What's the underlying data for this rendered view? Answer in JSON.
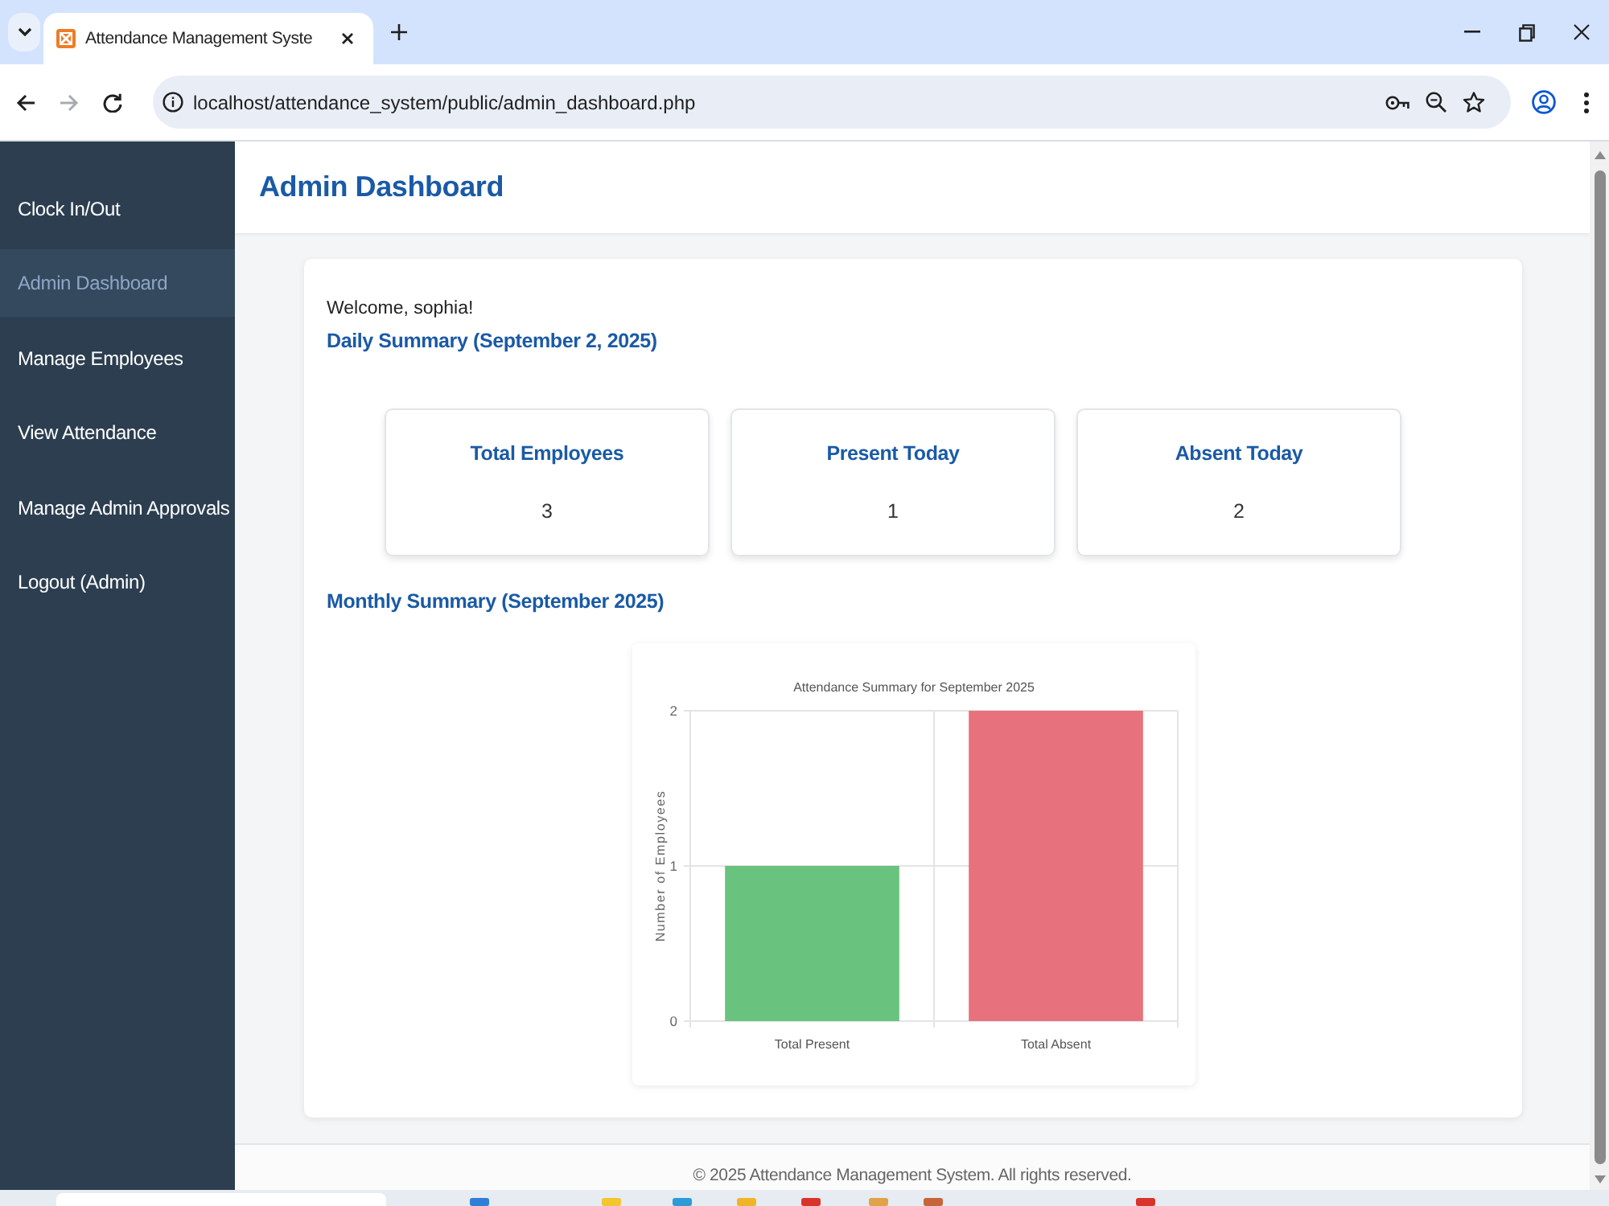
{
  "browser": {
    "tab": {
      "title": "Attendance Management Syste",
      "selected": true
    },
    "nav_buttons": [
      {
        "kind": "back",
        "disabled": false
      },
      {
        "kind": "forward",
        "disabled": true
      },
      {
        "kind": "reload",
        "disabled": false
      }
    ],
    "address_bar": {
      "url": "localhost/attendance_system/public/admin_dashboard.php"
    }
  },
  "sidebar": {
    "items": [
      {
        "label": "Clock In/Out",
        "selected": false
      },
      {
        "label": "Admin Dashboard",
        "selected": true
      },
      {
        "label": "Manage Employees",
        "selected": false
      },
      {
        "label": "View Attendance",
        "selected": false
      },
      {
        "label": "Manage Admin Approvals",
        "selected": false
      },
      {
        "label": "Logout (Admin)",
        "selected": false
      }
    ]
  },
  "header": {
    "title": "Admin Dashboard"
  },
  "welcome": "Welcome, sophia!",
  "daily_summary": {
    "heading": "Daily Summary (September 2, 2025)",
    "stats": [
      {
        "label": "Total Employees",
        "value": "3"
      },
      {
        "label": "Present Today",
        "value": "1"
      },
      {
        "label": "Absent Today",
        "value": "2"
      }
    ]
  },
  "monthly_summary": {
    "heading": "Monthly Summary (September 2025)",
    "chart_data": {
      "type": "bar",
      "title": "Attendance Summary for September 2025",
      "ylabel": "Number of Employees",
      "categories": [
        "Total Present",
        "Total Absent"
      ],
      "values": [
        1,
        2
      ],
      "colors": [
        "#69c27d",
        "#e7727d"
      ],
      "ylim": [
        0,
        2
      ],
      "yticks": [
        0,
        1,
        2
      ]
    }
  },
  "footer": {
    "text": "© 2025 Attendance Management System. All rights reserved."
  }
}
